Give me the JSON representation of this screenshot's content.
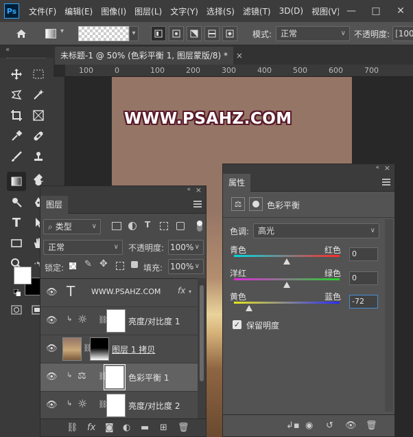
{
  "app": {
    "logo": "Ps"
  },
  "menu": [
    "文件(F)",
    "编辑(E)",
    "图像(I)",
    "图层(L)",
    "文字(Y)",
    "选择(S)",
    "滤镜(T)",
    "3D(D)",
    "视图(V)",
    "窗"
  ],
  "window_controls": {
    "minimize": "—",
    "maximize": "□",
    "close": "✕"
  },
  "options_bar": {
    "home_icon": "home-icon",
    "mode_label": "模式:",
    "mode_value": "正常",
    "opacity_label": "不透明度:",
    "opacity_value": "100"
  },
  "collapse_glyph": "«",
  "document_tab": {
    "title": "未标题-1 @ 50% (色彩平衡 1, 图层蒙版/8) *",
    "close": "×"
  },
  "ruler_ticks": [
    "100",
    "0",
    "100",
    "200",
    "300",
    "400",
    "500",
    "600",
    "700"
  ],
  "canvas": {
    "watermark": "WWW.PSAHZ.COM"
  },
  "layers_panel": {
    "collapse_glyph": "«",
    "close_glyph": "×",
    "tab": "图层",
    "filter_kind": "类型",
    "blend_mode": "正常",
    "opacity_label": "不透明度:",
    "opacity_value": "100%",
    "lock_label": "锁定:",
    "fill_label": "填充:",
    "fill_value": "100%",
    "layers": [
      {
        "name": "WWW.PSAHZ.COM",
        "kind": "text",
        "thumb_glyph": "T",
        "fx": "fx"
      },
      {
        "name": "亮度/对比度 1",
        "kind": "adjustment-brightness"
      },
      {
        "name": "图层 1 拷贝",
        "kind": "image"
      },
      {
        "name": "色彩平衡 1",
        "kind": "adjustment-color-balance",
        "selected": true
      },
      {
        "name": "亮度/对比度 2",
        "kind": "adjustment-brightness"
      }
    ],
    "footer_fx": "fx"
  },
  "properties_panel": {
    "collapse_glyph": "«",
    "close_glyph": "×",
    "tab": "属性",
    "title": "色彩平衡",
    "tone_label": "色调:",
    "tone_value": "高光",
    "sliders": [
      {
        "left": "青色",
        "right": "红色",
        "value": "0",
        "value_num": 0
      },
      {
        "left": "洋红",
        "right": "绿色",
        "value": "0",
        "value_num": 0
      },
      {
        "left": "黄色",
        "right": "蓝色",
        "value": "-72",
        "value_num": -72
      }
    ],
    "preserve_luminosity": "保留明度",
    "preserve_checked": true,
    "checkbox_glyph": "✓"
  },
  "colors": {
    "accent": "#31a8ff",
    "canvas_bg": "#957566",
    "watermark_outline": "#5a1b2a"
  }
}
